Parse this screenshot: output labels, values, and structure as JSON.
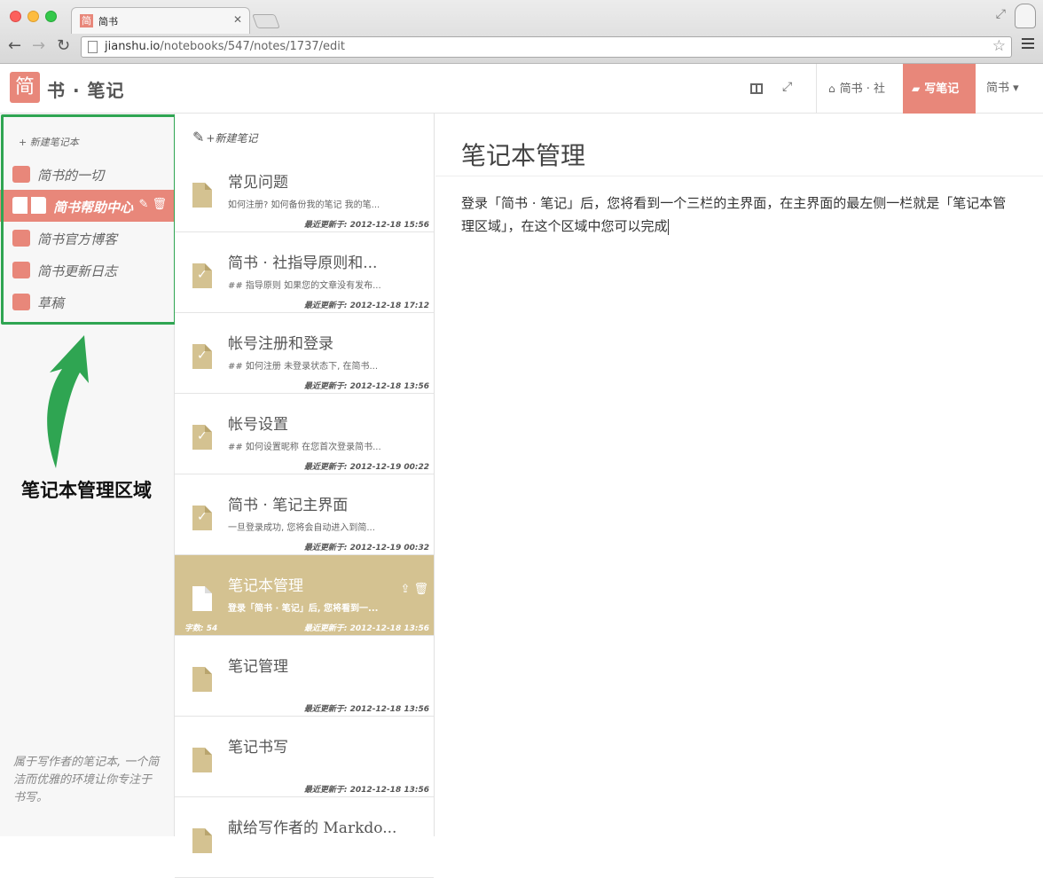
{
  "browser": {
    "tab_title": "简书",
    "favicon_char": "简",
    "url_host": "jianshu.io",
    "url_path": "/notebooks/547/notes/1737/edit"
  },
  "header": {
    "logo_char": "简",
    "brand": "书 · 笔记",
    "nav": {
      "home": "简书 · 社",
      "write": "写笔记",
      "user": "简书"
    },
    "accent_color": "#e8877a"
  },
  "notebooks": {
    "new_label": "+ 新建笔记本",
    "items": [
      {
        "label": "简书的一切",
        "active": false
      },
      {
        "label": "简书帮助中心",
        "active": true
      },
      {
        "label": "简书官方博客",
        "active": false
      },
      {
        "label": "简书更新日志",
        "active": false
      },
      {
        "label": "草稿",
        "active": false
      }
    ],
    "annotation": "笔记本管理区域",
    "annotation_color": "#2fa552",
    "footer": "属于写作者的笔记本, 一个简洁而优雅的环境让你专注于书写。"
  },
  "notes": {
    "new_label": "+新建笔记",
    "items": [
      {
        "title": "常见问题",
        "snippet": "如何注册? 如何备份我的笔记 我的笔...",
        "updated": "最近更新于: 2012-12-18 15:56",
        "checked": false
      },
      {
        "title": "简书 · 社指导原则和...",
        "snippet": "## 指导原则 如果您的文章没有发布...",
        "updated": "最近更新于: 2012-12-18 17:12",
        "checked": true
      },
      {
        "title": "帐号注册和登录",
        "snippet": "## 如何注册 未登录状态下, 在简书...",
        "updated": "最近更新于: 2012-12-18 13:56",
        "checked": true
      },
      {
        "title": "帐号设置",
        "snippet": "## 如何设置昵称 在您首次登录简书...",
        "updated": "最近更新于: 2012-12-19 00:22",
        "checked": true
      },
      {
        "title": "简书 · 笔记主界面",
        "snippet": "一旦登录成功, 您将会自动进入到简...",
        "updated": "最近更新于: 2012-12-19 00:32",
        "checked": true
      },
      {
        "title": "笔记本管理",
        "snippet": "登录「简书 · 笔记」后, 您将看到一...",
        "updated": "最近更新于: 2012-12-18 13:56",
        "word_count": "字数: 54",
        "active": true
      },
      {
        "title": "笔记管理",
        "snippet": "",
        "updated": "最近更新于: 2012-12-18 13:56",
        "checked": false
      },
      {
        "title": "笔记书写",
        "snippet": "",
        "updated": "最近更新于: 2012-12-18 13:56",
        "checked": false
      },
      {
        "title": "献给写作者的 Markdo...",
        "snippet": "",
        "updated": "",
        "checked": false
      }
    ],
    "accent_color": "#d4c291"
  },
  "editor": {
    "title": "笔记本管理",
    "body": "登录「简书 · 笔记」后，您将看到一个三栏的主界面，在主界面的最左侧一栏就是「笔记本管理区域」，在这个区域中您可以完成"
  }
}
